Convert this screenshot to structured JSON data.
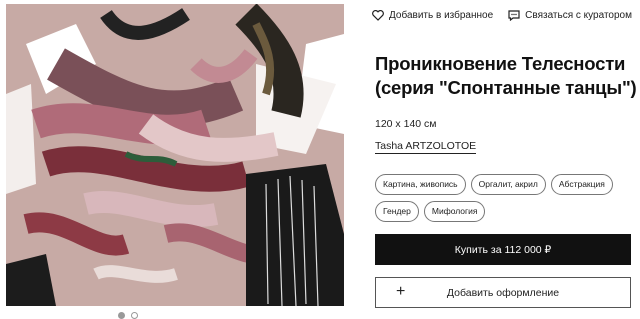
{
  "header": {
    "favorite_label": "Добавить в избранное",
    "curator_label": "Связаться с куратором"
  },
  "product": {
    "title": "Проникновение Телесности (серия \"Спонтанные танцы\")",
    "size": "120 x 140 см",
    "artist": "Tasha ARTZOLOTOE",
    "tags": [
      "Картина, живопись",
      "Оргалит, акрил",
      "Абстракция",
      "Гендер",
      "Мифология"
    ],
    "buy_label": "Купить за 112 000 ₽",
    "frame_label": "Добавить оформление"
  },
  "gallery": {
    "slides": 2,
    "active": 0
  },
  "colors": {
    "canvas_bg": "#c3a5a1",
    "buy_button_bg": "#111111",
    "buy_button_text": "#ffffff"
  }
}
